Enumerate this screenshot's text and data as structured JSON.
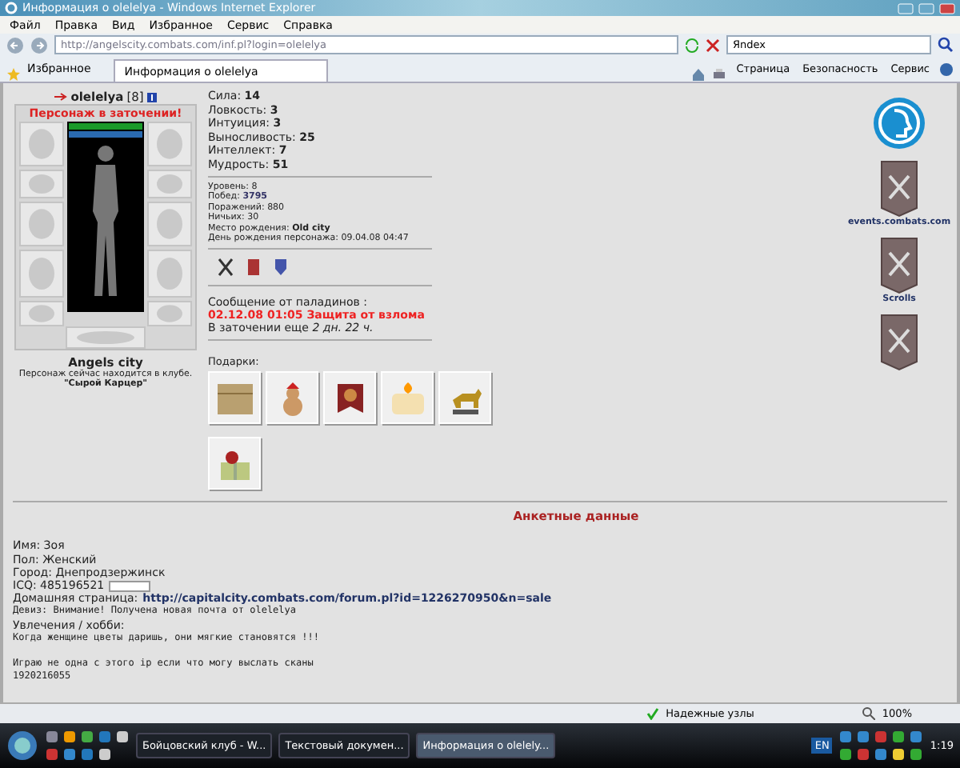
{
  "window": {
    "title": "Информация о olelelya - Windows Internet Explorer"
  },
  "menu": [
    "Файл",
    "Правка",
    "Вид",
    "Избранное",
    "Сервис",
    "Справка"
  ],
  "address": {
    "url": "http://angelscity.combats.com/inf.pl?login=olelelya",
    "search": "Яndex"
  },
  "favorites": "Избранное",
  "tabs": [
    {
      "label": "Информация о olelelya",
      "selected": true
    }
  ],
  "commands": [
    "Страница",
    "Безопасность",
    "Сервис"
  ],
  "character": {
    "name": "olelelya",
    "level": "[8]",
    "status": "Персонаж в заточении!",
    "hp": {
      "level": 1
    },
    "mana": {
      "level": 1
    },
    "city": "Angels city",
    "location": "Персонаж сейчас находится в клубе.",
    "room": "\"Сырой Карцер\""
  },
  "stats": [
    {
      "label": "Сила:",
      "value": "14"
    },
    {
      "label": "Ловкость:",
      "value": "3"
    },
    {
      "label": "Интуиция:",
      "value": "3"
    },
    {
      "label": "Выносливость:",
      "value": "25"
    },
    {
      "label": "Интеллект:",
      "value": "7"
    },
    {
      "label": "Мудрость:",
      "value": "51"
    }
  ],
  "info": [
    {
      "label": "Уровень:",
      "value": "8",
      "kind": "plain"
    },
    {
      "label": "Побед:",
      "value": "3795",
      "kind": "link"
    },
    {
      "label": "Поражений:",
      "value": "880",
      "kind": "plain"
    },
    {
      "label": "Ничьих:",
      "value": "30",
      "kind": "plain"
    },
    {
      "label": "Место рождения:",
      "value": "Old city",
      "kind": "bold"
    },
    {
      "label": "День рождения персонажа:",
      "value": "09.04.08 04:47",
      "kind": "plain"
    }
  ],
  "message": {
    "heading": "Сообщение от паладинов :",
    "text": "02.12.08 01:05 Защита от взлома",
    "remaining": "В заточении еще *2 дн. 22 ч.*"
  },
  "gifts_label": "Подарки:",
  "side_links": [
    "events.combats.com",
    "Scrolls"
  ],
  "profile": {
    "heading": "Анкетные данные",
    "lines": [
      {
        "kind": "plain",
        "text": "Имя: Зоя"
      },
      {
        "kind": "plain",
        "text": "Пол: Женский"
      },
      {
        "kind": "plain",
        "text": "Город: Днепродзержинск"
      },
      {
        "kind": "field",
        "text": "ICQ: 485196521"
      },
      {
        "kind": "link",
        "text": "Домашняя страница:",
        "link": "http://capitalcity.combats.com/forum.pl?id=1226270950&n=sale"
      },
      {
        "kind": "mono",
        "text": "Девиз: Внимание! Получена новая почта от olelelya"
      },
      {
        "kind": "plain",
        "text": "Увлечения / хобби:"
      },
      {
        "kind": "mono",
        "text": "Когда женщине цветы даришь, они мягкие становятся !!!"
      },
      {
        "kind": "gap"
      },
      {
        "kind": "mono",
        "text": "Играю не одна с этого ip если что могу выслать сканы"
      },
      {
        "kind": "mono",
        "text": "1920216055"
      }
    ]
  },
  "status_bar": {
    "zone": "Надежные узлы",
    "zoom": "100%"
  },
  "taskbar": {
    "items": [
      {
        "label": "Бойцовский клуб - W...",
        "selected": false
      },
      {
        "label": "Текстовый докумен...",
        "selected": false
      },
      {
        "label": "Информация о olelely...",
        "selected": true
      }
    ],
    "language": "EN",
    "time": "1:19"
  }
}
